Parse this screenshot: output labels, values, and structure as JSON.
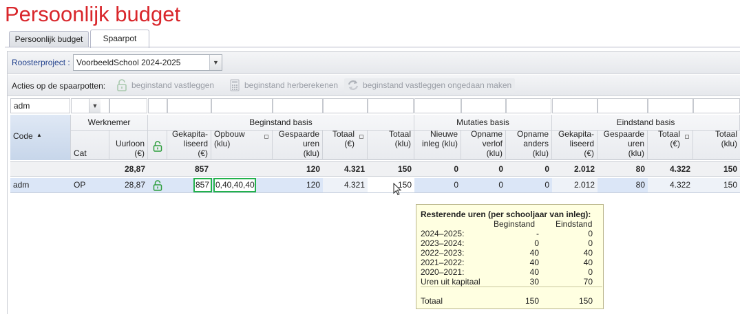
{
  "page_title": "Persoonlijk budget",
  "tabs": [
    {
      "label": "Persoonlijk budget",
      "active": false
    },
    {
      "label": "Spaarpot",
      "active": true
    }
  ],
  "roosterproject": {
    "label": "Roosterproject :",
    "value": "VoorbeeldSchool 2024-2025"
  },
  "acties": {
    "label": "Acties op de spaarpotten:",
    "buttons": [
      {
        "label": "beginstand vastleggen",
        "icon": "lock-open-icon"
      },
      {
        "label": "beginstand herberekenen",
        "icon": "calculator-icon"
      },
      {
        "label": "beginstand vastleggen ongedaan maken",
        "icon": "undo-refresh-icon"
      }
    ]
  },
  "filter": {
    "code_value": "adm"
  },
  "groups": {
    "werknemer": "Werknemer",
    "beginstand": "Beginstand basis",
    "mutaties": "Mutaties basis",
    "eindstand": "Eindstand basis"
  },
  "columns": {
    "code": "Code",
    "cat": "Cat",
    "uurloon": "Uurloon\n(€)",
    "gekap1": "Gekapita-\nliseerd\n(€)",
    "opbouw": "Opbouw\n(klu)",
    "gespaarde1": "Gespaarde\nuren\n(klu)",
    "totaal_eur1": "Totaal\n(€)",
    "totaal_klu1": "Totaal\n(klu)",
    "nieuwe_inleg": "Nieuwe\ninleg (klu)",
    "opname_verlof": "Opname\nverlof\n(klu)",
    "opname_anders": "Opname\nanders\n(klu)",
    "gekap2": "Gekapita-\nliseerd\n(€)",
    "gespaarde2": "Gespaarde\nuren\n(klu)",
    "totaal_eur2": "Totaal\n(€)",
    "totaal_klu2": "Totaal\n(klu)"
  },
  "totals": {
    "uurloon": "28,87",
    "gekap1": "857",
    "gespaarde1": "120",
    "totaal_eur1": "4.321",
    "totaal_klu1": "150",
    "nieuwe_inleg": "0",
    "opname_verlof": "0",
    "opname_anders": "0",
    "gekap2": "2.012",
    "gespaarde2": "80",
    "totaal_eur2": "4.322",
    "totaal_klu2": "150"
  },
  "row": {
    "code": "adm",
    "cat": "OP",
    "uurloon": "28,87",
    "gekap1": "857",
    "opbouw": "0,40,40,40",
    "gespaarde1": "120",
    "totaal_eur1": "4.321",
    "totaal_klu1": "150",
    "nieuwe_inleg": "0",
    "opname_verlof": "0",
    "opname_anders": "0",
    "gekap2": "2.012",
    "gespaarde2": "80",
    "totaal_eur2": "4.322",
    "totaal_klu2": "150"
  },
  "tooltip": {
    "title": "Resterende uren (per schooljaar van inleg):",
    "col1": "Beginstand",
    "col2": "Eindstand",
    "rows": [
      {
        "label": "2024–2025:",
        "begin": "-",
        "eind": "0"
      },
      {
        "label": "2023–2024:",
        "begin": "0",
        "eind": "0"
      },
      {
        "label": "2022–2023:",
        "begin": "40",
        "eind": "40"
      },
      {
        "label": "2021–2022:",
        "begin": "40",
        "eind": "40"
      },
      {
        "label": "2020–2021:",
        "begin": "40",
        "eind": "0"
      },
      {
        "label": "Uren uit kapitaal",
        "begin": "30",
        "eind": "70"
      }
    ],
    "total": {
      "label": "Totaal",
      "begin": "150",
      "eind": "150"
    }
  },
  "colors": {
    "title": "#d9262b",
    "edit_border": "#22b14c",
    "lock": "#2e9e3e"
  }
}
